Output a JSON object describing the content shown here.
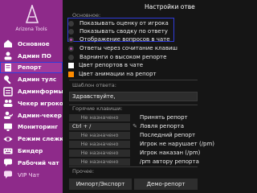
{
  "app": {
    "logo_text": "Arizona Tools",
    "window_title": "Настройки отве"
  },
  "sidebar": {
    "items": [
      {
        "label": "Основное",
        "icon": "home-icon"
      },
      {
        "label": "Админ ПО",
        "icon": "admin-icon"
      },
      {
        "label": "Репорт",
        "icon": "report-icon",
        "active": true
      },
      {
        "label": "Админ тулс",
        "icon": "tools-icon"
      },
      {
        "label": "Админформы",
        "icon": "forms-icon"
      },
      {
        "label": "Чекер игроков",
        "icon": "players-icon"
      },
      {
        "label": "Админ-чекер",
        "icon": "admin-checker-icon"
      },
      {
        "label": "Мониторинг",
        "icon": "monitor-icon"
      },
      {
        "label": "Режим слежки",
        "icon": "eye-icon"
      },
      {
        "label": "Биндер",
        "icon": "keyboard-icon"
      },
      {
        "label": "Рабочий чат",
        "icon": "chat-icon"
      },
      {
        "label": "VIP Чат",
        "icon": "vip-chat-icon"
      }
    ]
  },
  "settings": {
    "basic_label": "Основное:",
    "toggles": [
      {
        "label": "Показывать оценку от игрока",
        "state": false
      },
      {
        "label": "Показывать сводку по ответу",
        "state": false
      },
      {
        "label": "Отображение вопросов в чате",
        "state": true
      },
      {
        "label": "Ответы через сочитание клавиш",
        "state": true
      },
      {
        "label": "Варнинги о высоком репорте",
        "state": false
      }
    ],
    "color_items": [
      {
        "label": "Цвет репортов в чате",
        "color": "#ffffff"
      },
      {
        "label": "Цвет анимации на репорт",
        "color": "#ff8c00"
      }
    ],
    "template_label": "Шаблон ответа:",
    "template_value": "Здравствуйте,",
    "hotkeys_label": "Горячие клавиши:",
    "hotkeys": [
      {
        "key": "Не назначено",
        "mod": "",
        "label": "Принять репорт"
      },
      {
        "key": "Ctrl + /",
        "mod": "✎",
        "label": "Ловля репорта"
      },
      {
        "key": "Не назначено",
        "mod": "",
        "label": "Последний репорт"
      },
      {
        "key": "Не назначено",
        "mod": "",
        "label": "Игрок не нарушает (/pm)"
      },
      {
        "key": "Не назначено",
        "mod": "",
        "label": "Игрок наказан (/pm)"
      },
      {
        "key": "Не назначено",
        "mod": "",
        "label": "/pm автору репорта"
      }
    ],
    "other_label": "Прочее:",
    "import_export_label": "Импорт/Экспорт",
    "demo_report_label": "Демо-репорт"
  }
}
